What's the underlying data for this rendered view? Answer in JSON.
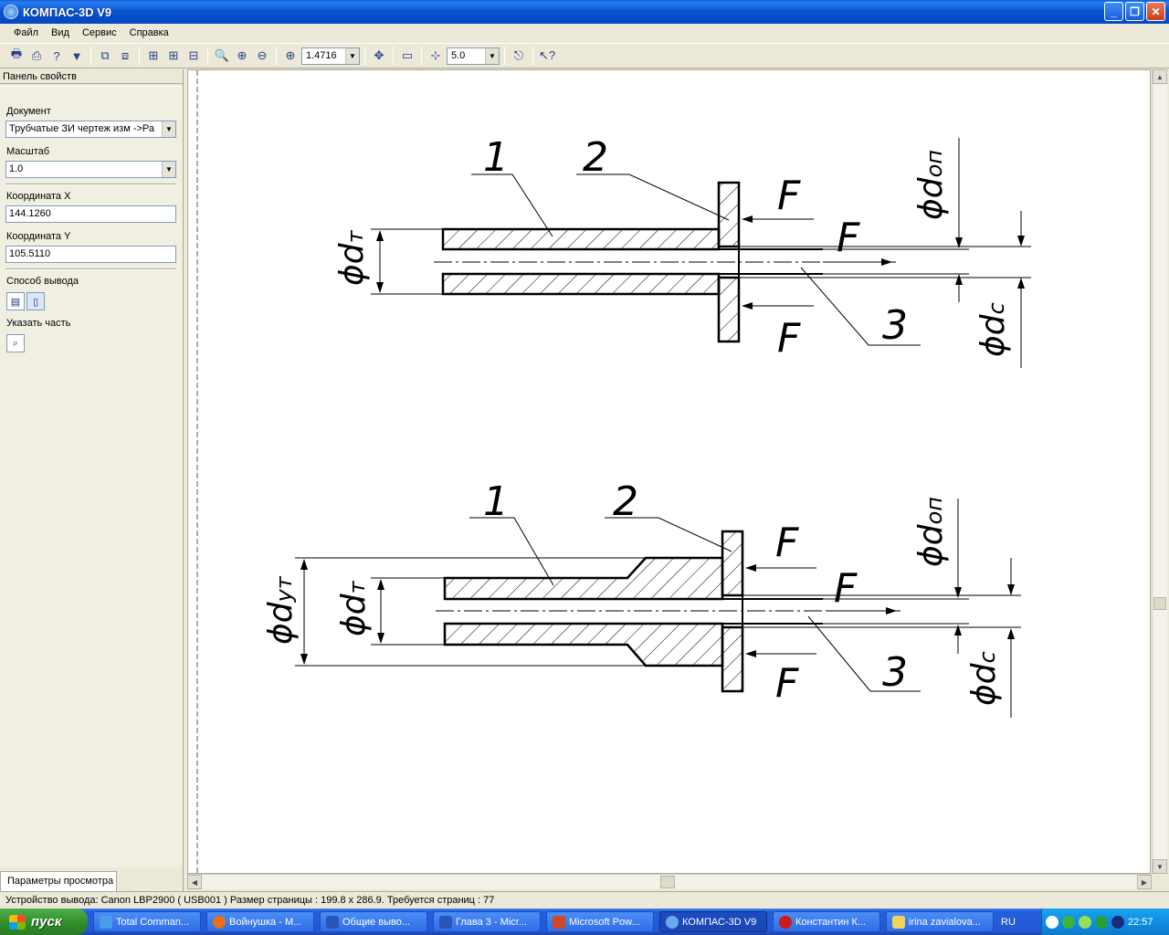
{
  "window": {
    "title": "КОМПАС-3D V9"
  },
  "menu": [
    "Файл",
    "Вид",
    "Сервис",
    "Справка"
  ],
  "toolbar": {
    "zoom_value": "1.4716",
    "step_value": "5.0"
  },
  "panel": {
    "title": "Панель свойств",
    "document_label": "Документ",
    "document_value": "Трубчатые ЗИ чертеж изм ->Ра",
    "scale_label": "Масштаб",
    "scale_value": "1.0",
    "coord_x_label": "Координата X",
    "coord_x_value": "144.1260",
    "coord_y_label": "Координата Y",
    "coord_y_value": "105.5110",
    "output_label": "Способ вывода",
    "part_label": "Указать часть",
    "tab_label": "Параметры просмотра"
  },
  "drawing": {
    "top": {
      "labels": [
        "1",
        "2",
        "3"
      ],
      "force": "F",
      "dims": [
        "ϕd",
        "т",
        "ϕd",
        "оп",
        "ϕd",
        "с"
      ]
    },
    "bottom": {
      "labels": [
        "1",
        "2",
        "3"
      ],
      "force": "F",
      "dims": [
        "ϕd",
        "ут",
        "ϕd",
        "т",
        "ϕd",
        "оп",
        "ϕd",
        "с"
      ]
    }
  },
  "statusbar": {
    "text": "Устройство вывода: Canon LBP2900 ( USB001 )  Размер страницы : 199.8 x 286.9.  Требуется страниц : 77"
  },
  "taskbar": {
    "start": "пуск",
    "items": [
      "Total Comman...",
      "Войнушка - М...",
      "Общие выво...",
      "Глава 3 - Micr...",
      "Microsoft Pow...",
      "КОМПАС-3D V9",
      "Константин К...",
      "irina zavialova..."
    ],
    "lang": "RU",
    "clock": "22:57"
  },
  "colors": {
    "titlebar": "#0a56d0",
    "taskbar": "#245edb",
    "start": "#2f8a2a"
  }
}
